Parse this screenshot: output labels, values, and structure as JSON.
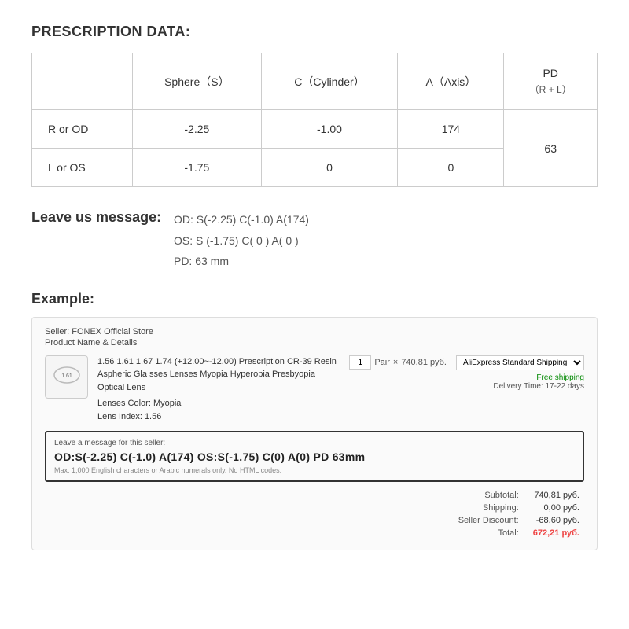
{
  "page": {
    "prescription_title": "PRESCRIPTION DATA:",
    "table": {
      "headers": {
        "col1": "",
        "col2": "Sphere（S）",
        "col3": "C（Cylinder）",
        "col4": "A（Axis）",
        "col5": "PD",
        "col5_sub": "（R + L）"
      },
      "rows": [
        {
          "label": "R or OD",
          "sphere": "-2.25",
          "cylinder": "-1.00",
          "axis": "174",
          "pd": ""
        },
        {
          "label": "L or OS",
          "sphere": "-1.75",
          "cylinder": "0",
          "axis": "0",
          "pd": "63"
        }
      ]
    },
    "message_section": {
      "title": "Leave us message:",
      "lines": [
        "OD:  S(-2.25)    C(-1.0)   A(174)",
        "OS:  S (-1.75)    C( 0 )    A( 0 )",
        "PD:  63 mm"
      ]
    },
    "example_section": {
      "title": "Example:",
      "seller": "Seller: FONEX Official Store",
      "product_label": "Product Name & Details",
      "product_name": "1.56 1.61 1.67 1.74 (+12.00~-12.00) Prescription CR-39 Resin Aspheric Gla sses Lenses Myopia Hyperopia Presbyopia Optical Lens",
      "lens_color_label": "Lenses Color:",
      "lens_color_value": "Myopia",
      "lens_index_label": "Lens Index:",
      "lens_index_value": "1.56",
      "lens_icon_label": "1.61",
      "qty_value": "1",
      "qty_unit": "Pair",
      "price": "740,81 руб.",
      "shipping_option": "AliExpress Standard Shipping",
      "free_shipping": "Free shipping",
      "delivery_label": "Delivery Time: 17-22 days",
      "message_box_label": "Leave a message for this seller:",
      "message_box_text": "OD:S(-2.25) C(-1.0) A(174)  OS:S(-1.75) C(0) A(0)  PD  63mm",
      "message_box_hint": "Max. 1,000 English characters or Arabic numerals only. No HTML codes.",
      "subtotal_label": "Subtotal:",
      "subtotal_value": "740,81 руб.",
      "shipping_label": "Shipping:",
      "shipping_value": "0,00 руб.",
      "discount_label": "Seller Discount:",
      "discount_value": "-68,60 руб.",
      "total_label": "Total:",
      "total_value": "672,21 руб."
    }
  }
}
